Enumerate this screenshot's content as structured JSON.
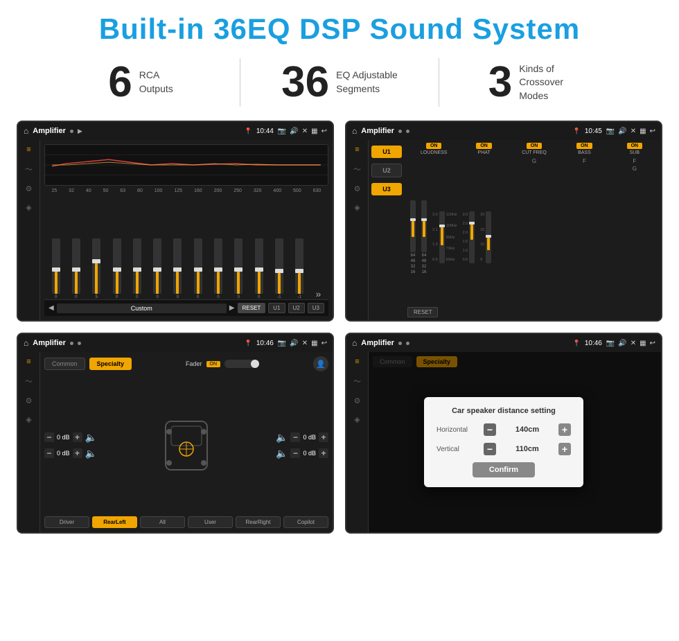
{
  "header": {
    "title": "Built-in 36EQ DSP Sound System"
  },
  "stats": [
    {
      "number": "6",
      "line1": "RCA",
      "line2": "Outputs"
    },
    {
      "number": "36",
      "line1": "EQ Adjustable",
      "line2": "Segments"
    },
    {
      "number": "3",
      "line1": "Kinds of",
      "line2": "Crossover Modes"
    }
  ],
  "screens": {
    "eq": {
      "topbar": {
        "title": "Amplifier",
        "time": "10:44"
      },
      "freq_labels": [
        "25",
        "32",
        "40",
        "50",
        "63",
        "80",
        "100",
        "125",
        "160",
        "200",
        "250",
        "320",
        "400",
        "500",
        "630"
      ],
      "sliders": [
        0,
        0,
        5,
        0,
        0,
        0,
        0,
        0,
        0,
        0,
        0,
        "-1",
        "-1"
      ],
      "preset": "Custom",
      "buttons": [
        "RESET",
        "U1",
        "U2",
        "U3"
      ]
    },
    "crossover": {
      "topbar": {
        "title": "Amplifier",
        "time": "10:45"
      },
      "groups": [
        "U1",
        "U2",
        "U3"
      ],
      "channels": [
        "LOUDNESS",
        "PHAT",
        "CUT FREQ",
        "BASS",
        "SUB"
      ]
    },
    "speaker": {
      "topbar": {
        "title": "Amplifier",
        "time": "10:46"
      },
      "tabs": [
        "Common",
        "Specialty"
      ],
      "fader_label": "Fader",
      "controls": [
        "0 dB",
        "0 dB",
        "0 dB",
        "0 dB"
      ],
      "bottom_btns": [
        "Driver",
        "RearLeft",
        "All",
        "User",
        "RearRight",
        "Copilot"
      ]
    },
    "dialog": {
      "topbar": {
        "title": "Amplifier",
        "time": "10:46"
      },
      "tabs": [
        "Common",
        "Specialty"
      ],
      "dialog": {
        "title": "Car speaker distance setting",
        "rows": [
          {
            "label": "Horizontal",
            "value": "140cm"
          },
          {
            "label": "Vertical",
            "value": "110cm"
          }
        ],
        "confirm": "Confirm"
      }
    }
  }
}
